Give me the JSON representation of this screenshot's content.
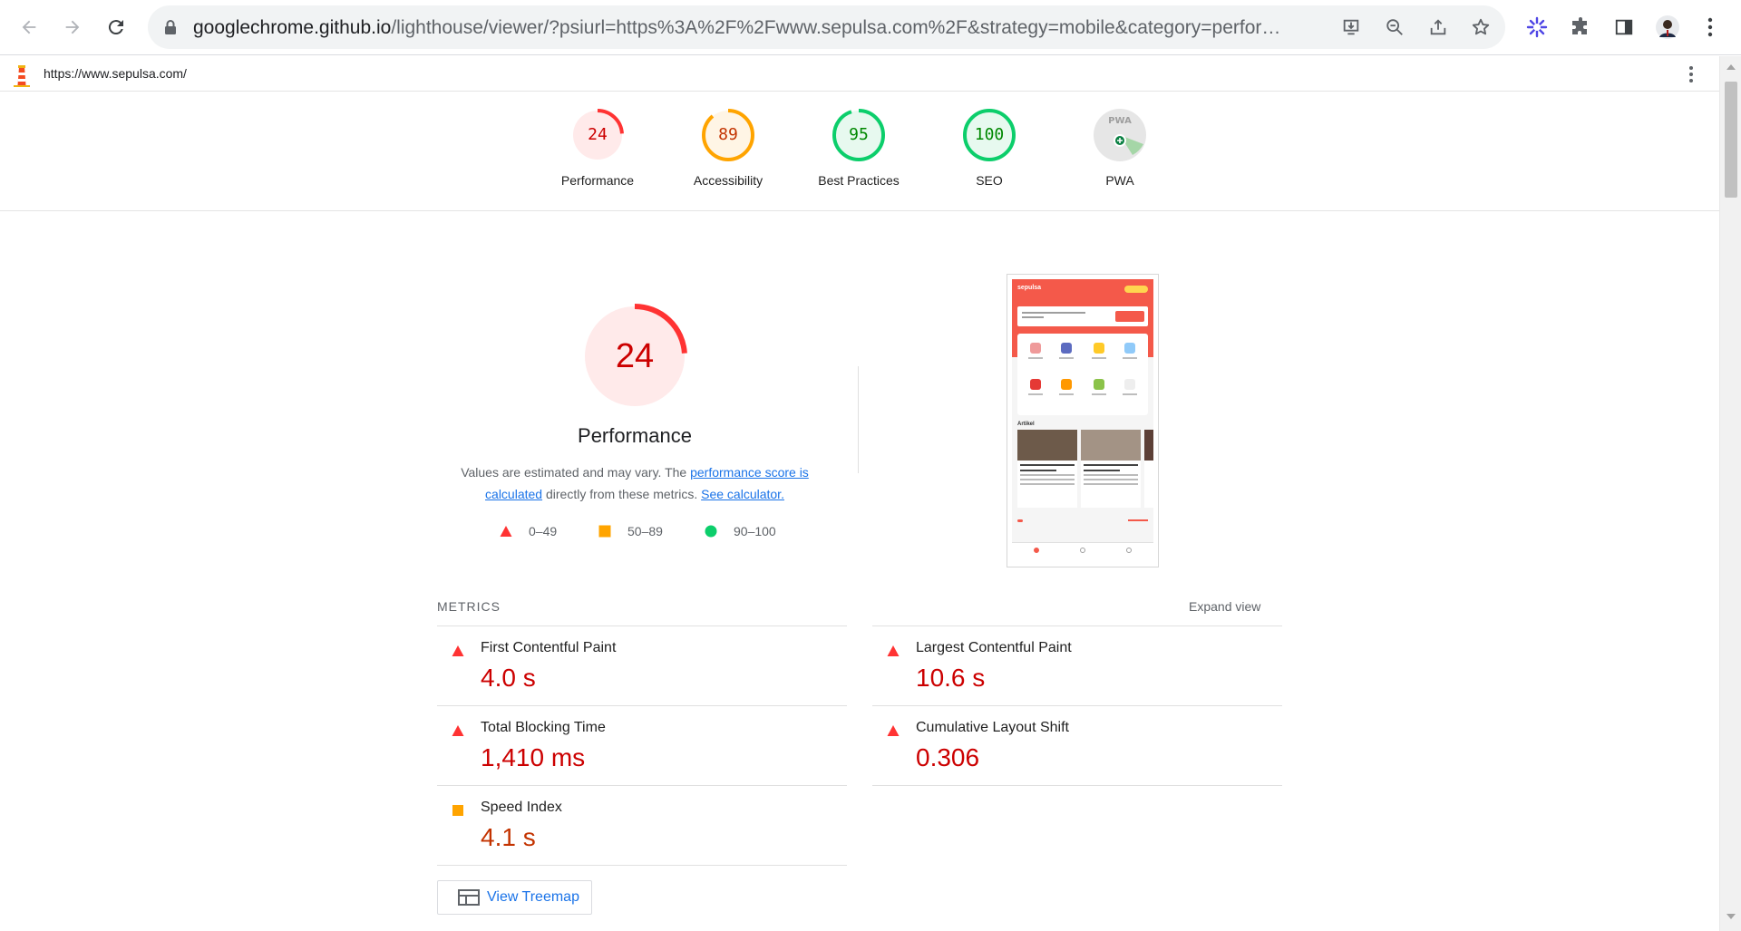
{
  "browser": {
    "url_host": "googlechrome.github.io",
    "url_path": "/lighthouse/viewer/?psiurl=https%3A%2F%2Fwww.sepulsa.com%2F&strategy=mobile&category=performance&category=accessibility&category=best-practices&category=seo&category=pwa"
  },
  "report": {
    "url": "https://www.sepulsa.com/"
  },
  "gauges": [
    {
      "label": "Performance",
      "score": "24",
      "fraction": 0.24,
      "color": "#ff3333",
      "bg": "#ffeaea",
      "text_color": "#cc0000"
    },
    {
      "label": "Accessibility",
      "score": "89",
      "fraction": 0.89,
      "color": "#ffa400",
      "bg": "#fff5e5",
      "text_color": "#c33300"
    },
    {
      "label": "Best Practices",
      "score": "95",
      "fraction": 0.95,
      "color": "#0cce6b",
      "bg": "#e7f9ef",
      "text_color": "#008800"
    },
    {
      "label": "SEO",
      "score": "100",
      "fraction": 1.0,
      "color": "#0cce6b",
      "bg": "#e7f9ef",
      "text_color": "#008800"
    },
    {
      "label": "PWA",
      "score": "PWA",
      "fraction": 0.3,
      "color": "#9e9e9e",
      "bg": "#e6e6e6",
      "text_color": "#9e9e9e"
    }
  ],
  "performance": {
    "score": "24",
    "title": "Performance",
    "desc_prefix": "Values are estimated and may vary. The ",
    "desc_link1": "performance score is calculated",
    "desc_middle": " directly from these metrics. ",
    "desc_link2": "See calculator."
  },
  "legend": [
    {
      "range": "0–49",
      "shape": "triangle",
      "color": "#ff3333"
    },
    {
      "range": "50–89",
      "shape": "square",
      "color": "#ffa400"
    },
    {
      "range": "90–100",
      "shape": "circle",
      "color": "#0cce6b"
    }
  ],
  "thumbnail": {
    "logo": "sepulsa",
    "section_title": "Artikel"
  },
  "metrics": {
    "heading": "METRICS",
    "expand_label": "Expand view",
    "items": [
      {
        "name": "First Contentful Paint",
        "value": "4.0 s",
        "status": "fail"
      },
      {
        "name": "Largest Contentful Paint",
        "value": "10.6 s",
        "status": "fail"
      },
      {
        "name": "Total Blocking Time",
        "value": "1,410 ms",
        "status": "fail"
      },
      {
        "name": "Cumulative Layout Shift",
        "value": "0.306",
        "status": "fail"
      },
      {
        "name": "Speed Index",
        "value": "4.1 s",
        "status": "average"
      }
    ]
  },
  "treemap_label": "View Treemap",
  "colors": {
    "fail": "#cc0000",
    "average": "#c33300",
    "link": "#1a73e8"
  }
}
